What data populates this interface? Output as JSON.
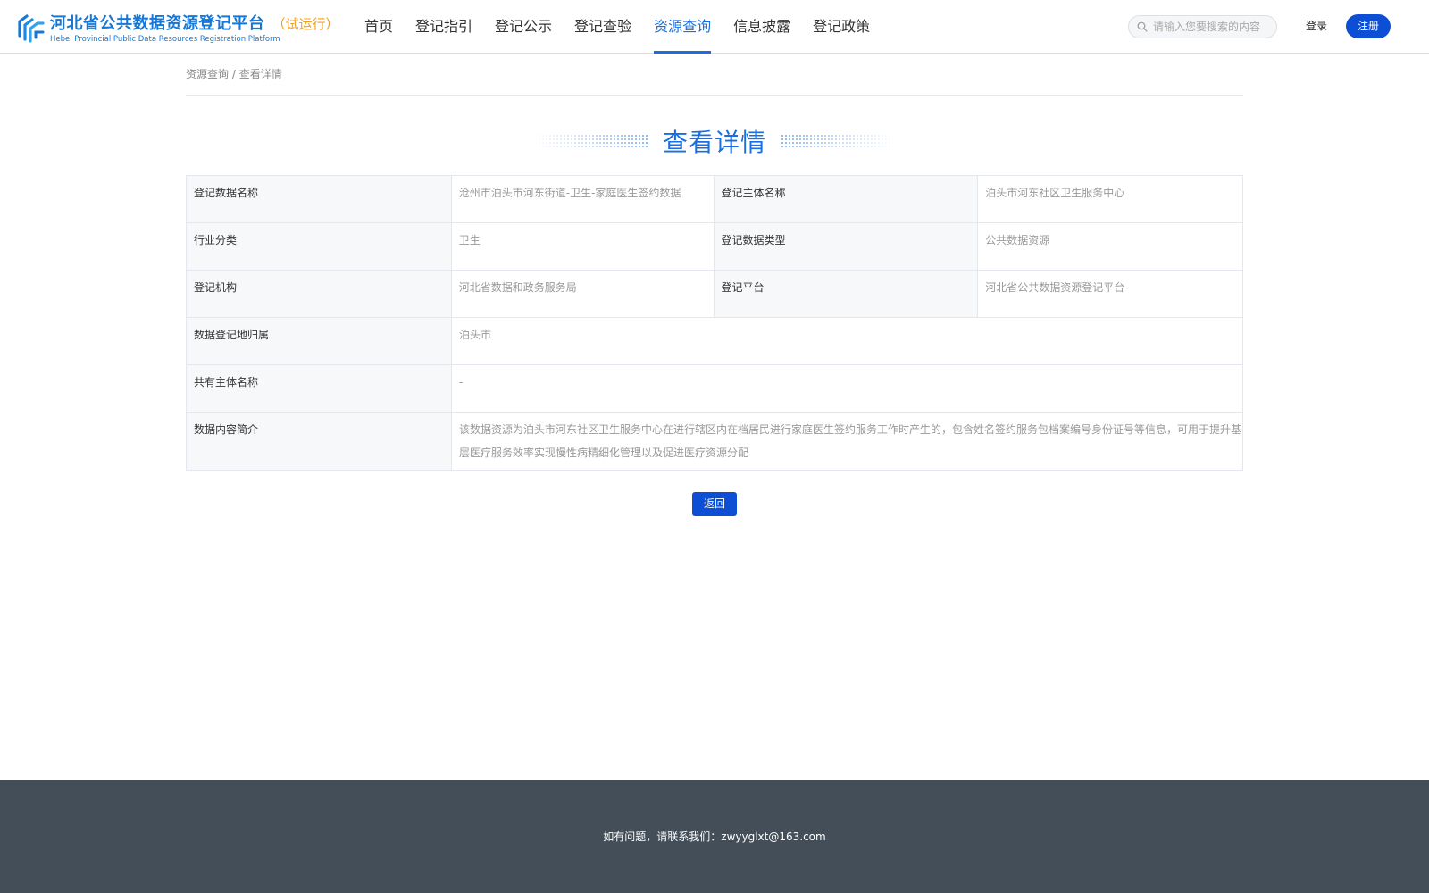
{
  "header": {
    "logo_cn": "河北省公共数据资源登记平台",
    "logo_trial": "（试运行）",
    "logo_en": "Hebei Provincial Public Data Resources Registration Platform",
    "nav": [
      {
        "label": "首页",
        "active": false
      },
      {
        "label": "登记指引",
        "active": false
      },
      {
        "label": "登记公示",
        "active": false
      },
      {
        "label": "登记查验",
        "active": false
      },
      {
        "label": "资源查询",
        "active": true
      },
      {
        "label": "信息披露",
        "active": false
      },
      {
        "label": "登记政策",
        "active": false
      }
    ],
    "search_placeholder": "请输入您要搜索的内容",
    "login_label": "登录",
    "register_label": "注册"
  },
  "breadcrumb": {
    "parent": "资源查询",
    "separator": " / ",
    "current": "查看详情"
  },
  "page_title": "查看详情",
  "detail": {
    "rows": [
      {
        "label1": "登记数据名称",
        "value1": "沧州市泊头市河东街道-卫生-家庭医生签约数据",
        "label2": "登记主体名称",
        "value2": "泊头市河东社区卫生服务中心"
      },
      {
        "label1": "行业分类",
        "value1": "卫生",
        "label2": "登记数据类型",
        "value2": "公共数据资源"
      },
      {
        "label1": "登记机构",
        "value1": "河北省数据和政务服务局",
        "label2": "登记平台",
        "value2": "河北省公共数据资源登记平台"
      }
    ],
    "location_label": "数据登记地归属",
    "location_value": "泊头市",
    "coowner_label": "共有主体名称",
    "coowner_value": "-",
    "summary_label": "数据内容简介",
    "summary_value": "该数据资源为泊头市河东社区卫生服务中心在进行辖区内在档居民进行家庭医生签约服务工作时产生的，包含姓名签约服务包档案编号身份证号等信息，可用于提升基层医疗服务效率实现慢性病精细化管理以及促进医疗资源分配"
  },
  "back_label": "返回",
  "footer": {
    "contact": "如有问题，请联系我们：zwyyglxt@163.com"
  },
  "colors": {
    "brand_blue": "#1a6ee0",
    "button_blue": "#0c4fd4",
    "trial_orange": "#f0a020",
    "footer_bg": "#434e59"
  }
}
